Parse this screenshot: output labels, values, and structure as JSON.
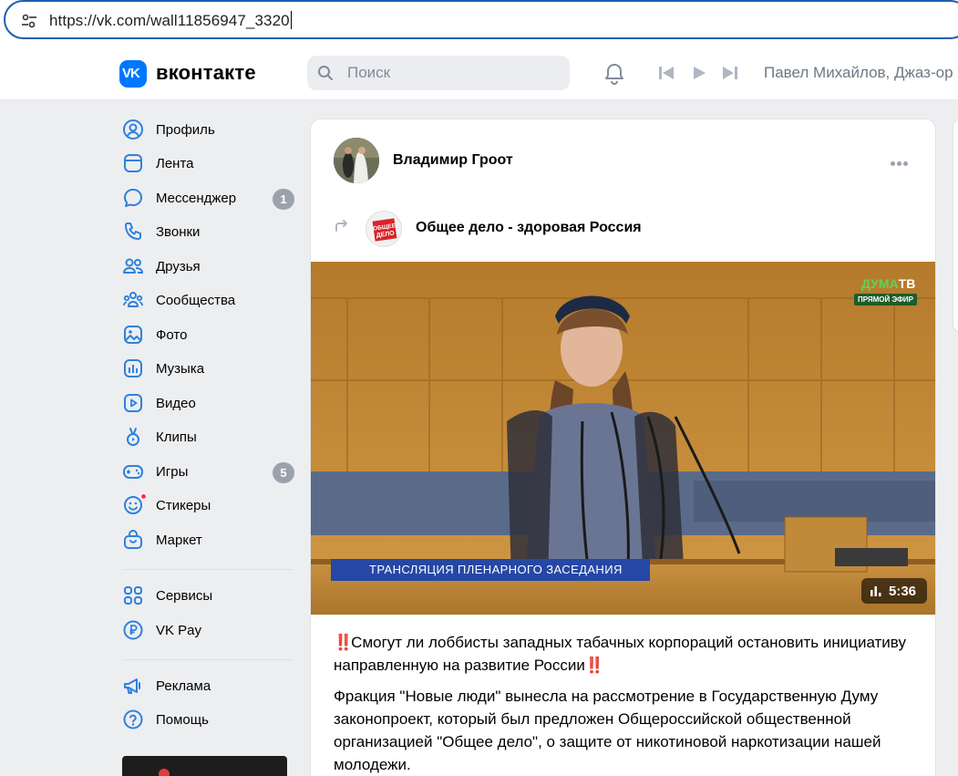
{
  "browser": {
    "url": "https://vk.com/wall11856947_3320",
    "site_info_icon": "tune-icon"
  },
  "header": {
    "logo_text": "вконтакте",
    "logo_mark": "VK",
    "search_placeholder": "Поиск",
    "now_playing": "Павел Михайлов, Джаз-ор",
    "icons": [
      "bell-icon",
      "prev-track-icon",
      "play-icon",
      "next-track-icon"
    ]
  },
  "nav": {
    "items": [
      {
        "label": "Профиль",
        "icon": "profile-icon"
      },
      {
        "label": "Лента",
        "icon": "feed-icon"
      },
      {
        "label": "Мессенджер",
        "icon": "messenger-icon",
        "badge": "1"
      },
      {
        "label": "Звонки",
        "icon": "phone-icon"
      },
      {
        "label": "Друзья",
        "icon": "friends-icon"
      },
      {
        "label": "Сообщества",
        "icon": "communities-icon"
      },
      {
        "label": "Фото",
        "icon": "photo-icon"
      },
      {
        "label": "Музыка",
        "icon": "music-icon"
      },
      {
        "label": "Видео",
        "icon": "video-icon"
      },
      {
        "label": "Клипы",
        "icon": "clips-icon"
      },
      {
        "label": "Игры",
        "icon": "games-icon",
        "badge": "5"
      },
      {
        "label": "Стикеры",
        "icon": "stickers-icon"
      },
      {
        "label": "Маркет",
        "icon": "market-icon"
      },
      {
        "label": "Сервисы",
        "icon": "services-icon"
      },
      {
        "label": "VK Pay",
        "icon": "vkpay-icon"
      },
      {
        "label": "Реклама",
        "icon": "ads-icon"
      },
      {
        "label": "Помощь",
        "icon": "help-icon"
      }
    ]
  },
  "post": {
    "author": "Владимир Гроот",
    "repost_source": "Общее дело - здоровая Россия",
    "group_avatar_text": "ОБЩЕЕ ДЕЛО",
    "video": {
      "channel_logo_a": "ДУМА",
      "channel_logo_b": "ТВ",
      "live_tag": "ПРЯМОЙ ЭФИР",
      "ticker": "ТРАНСЛЯЦИЯ ПЛЕНАРНОГО ЗАСЕДАНИЯ",
      "duration": "5:36"
    },
    "title_marks": "‼️",
    "title": "Смогут ли лоббисты западных табачных корпораций остановить инициативу направленную на развитие России",
    "text": "Фракция \"Новые люди\" вынесла на рассмотрение в Государственную Думу законопроект, который был предложен Общероссийской общественной организацией \"Общее дело\", о защите от никотиновой наркотизации нашей молодежи."
  },
  "colors": {
    "accent": "#0077ff",
    "badge": "#99a2ad",
    "page_bg": "#edeef0"
  }
}
